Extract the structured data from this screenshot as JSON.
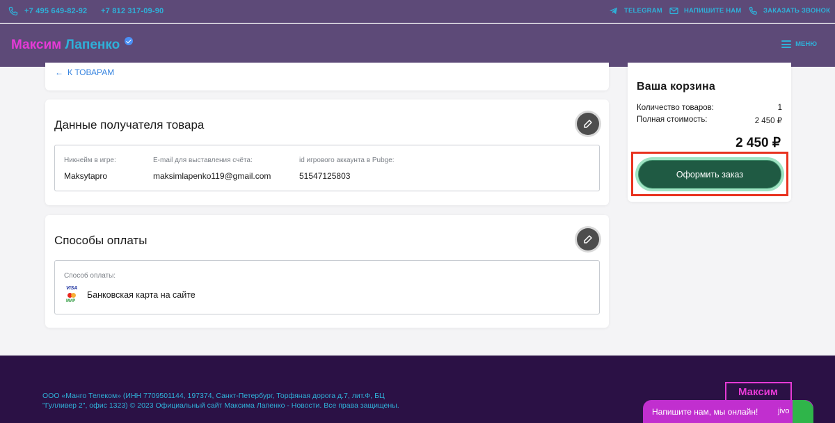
{
  "topbar": {
    "phone1": "+7 495 649-82-92",
    "phone2": "+7 812 317-09-90",
    "telegram": "TELEGRAM",
    "write_us": "НАПИШИТЕ НАМ",
    "order_call": "ЗАКАЗАТЬ ЗВОНОК"
  },
  "navbar": {
    "logo_part1": "Максим",
    "logo_part2": "Лапенко",
    "menu_label": "МЕНЮ"
  },
  "back": {
    "label": "К ТОВАРАМ"
  },
  "recipient": {
    "title": "Данные получателя товара",
    "fields": [
      {
        "label": "Никнейм в игре:",
        "value": "Maksytapro"
      },
      {
        "label": "E-mail для выставления счёта:",
        "value": "maksimlapenko119@gmail.com"
      },
      {
        "label": "id игрового аккаунта в Pubge:",
        "value": "51547125803"
      }
    ]
  },
  "payment": {
    "title": "Способы оплаты",
    "label": "Способ оплаты:",
    "method": "Банковская карта на сайте",
    "card_logos": {
      "visa": "VISA",
      "mir": "МИР"
    }
  },
  "cart": {
    "title": "Ваша корзина",
    "count_label": "Количество товаров:",
    "count_value": "1",
    "total_label": "Полная стоимость:",
    "total_value": "2 450 ₽",
    "grand_total": "2 450 ₽",
    "order_button": "Оформить заказ"
  },
  "footer": {
    "legal_line1": "ООО «Манго Телеком» (ИНН 7709501144, 197374, Санкт-Петербург, Торфяная дорога д.7, лит.Ф, БЦ",
    "legal_line2": "\"Гулливер 2\", офис 1323) © 2023 Официальный сайт Максима Лапенко - Новости. Все права защищены.",
    "logo_text": "Максим"
  },
  "chat": {
    "text": "Напишите нам, мы онлайн!",
    "brand": "jivo"
  },
  "colors": {
    "header_bg": "#5d4a78",
    "accent_cyan": "#2fb0d8",
    "accent_pink": "#e63ad6",
    "order_button_bg": "#1f5a43",
    "highlight_border": "#e8321f",
    "footer_bg": "#2b1145"
  }
}
